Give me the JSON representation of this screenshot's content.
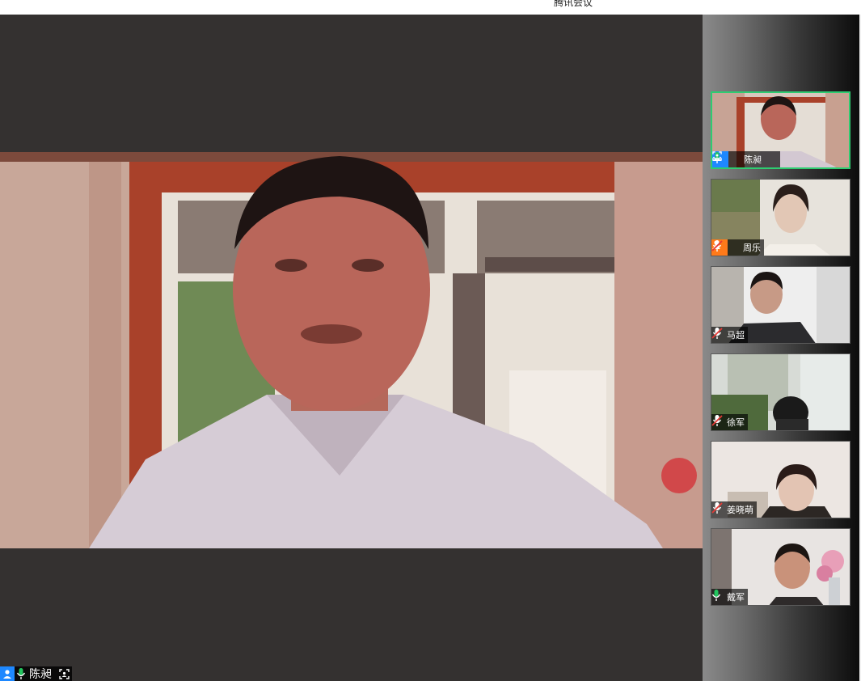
{
  "window": {
    "title": "腾讯会议"
  },
  "main": {
    "speaker": {
      "name": "陈昶",
      "role": "host",
      "mic": "on"
    }
  },
  "participants": [
    {
      "name": "陈昶",
      "role": "host",
      "mic": "on",
      "active": true,
      "screen_icon": true
    },
    {
      "name": "周乐",
      "role": "cohost",
      "mic": "muted",
      "active": false
    },
    {
      "name": "马超",
      "role": "",
      "mic": "muted",
      "active": false
    },
    {
      "name": "徐军",
      "role": "",
      "mic": "muted",
      "active": false
    },
    {
      "name": "姜晓萌",
      "role": "",
      "mic": "muted",
      "active": false
    },
    {
      "name": "戴军",
      "role": "",
      "mic": "on",
      "active": false
    }
  ],
  "colors": {
    "host_badge": "#1e88ff",
    "cohost_badge": "#ff7a1a",
    "mic_on": "#22c55e",
    "mic_muted": "#e53935",
    "active_border": "#2ecc71",
    "stage_bg": "#343130"
  },
  "icons": {
    "host": "person-icon",
    "mic_on": "microphone-icon",
    "mic_muted": "microphone-muted-icon",
    "screen": "screen-frame-icon"
  }
}
